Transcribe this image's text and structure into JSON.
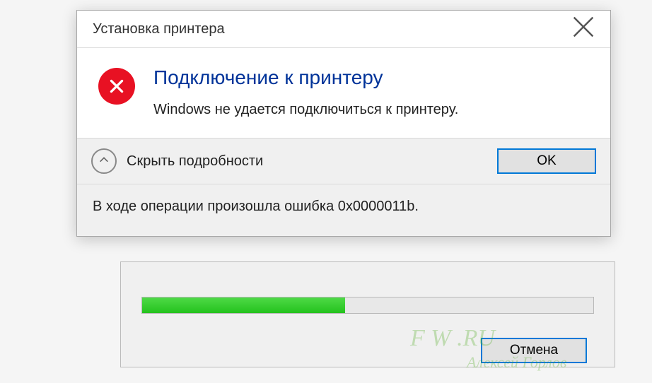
{
  "dialog": {
    "title": "Установка принтера",
    "heading": "Подключение к принтеру",
    "message": "Windows не удается подключиться к принтеру.",
    "details_toggle_label": "Скрыть подробности",
    "ok_label": "OK",
    "details_text": "В ходе операции произошла ошибка 0x0000011b."
  },
  "background": {
    "cancel_label": "Отмена",
    "progress_percent": 45,
    "watermark_line1": "F    W     .RU",
    "watermark_line2": "Алексей Горлов"
  },
  "colors": {
    "accent": "#0078d7",
    "error": "#e81123",
    "heading": "#003399",
    "progress": "#24c21d"
  }
}
